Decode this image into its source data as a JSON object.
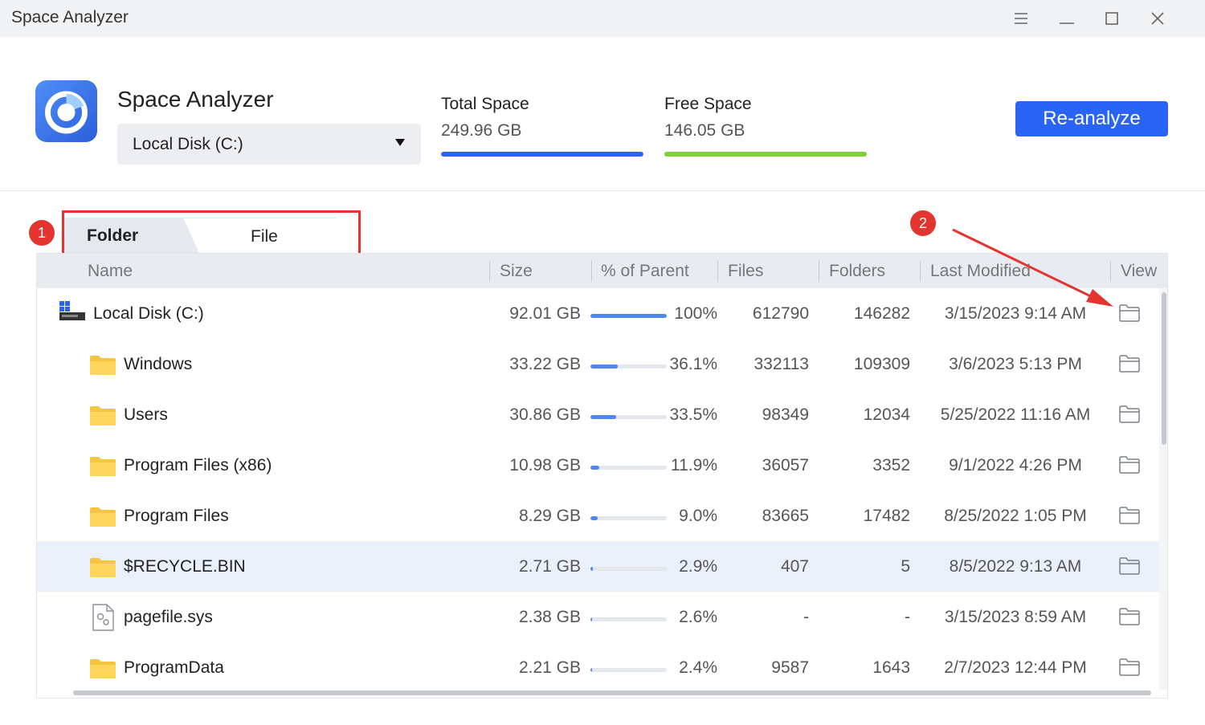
{
  "window": {
    "title": "Space Analyzer"
  },
  "header": {
    "app_name": "Space Analyzer",
    "disk_selected": "Local Disk (C:)",
    "total_space": {
      "label": "Total Space",
      "value": "249.96 GB",
      "fill": 1.0,
      "color": "#2a64f6"
    },
    "free_space": {
      "label": "Free Space",
      "value": "146.05 GB",
      "fill": 1.0,
      "color": "#7bd13b"
    },
    "reanalyze_label": "Re-analyze"
  },
  "annotations": {
    "badge_1": "1",
    "badge_2": "2"
  },
  "tabs": {
    "folder": "Folder",
    "file": "File",
    "active": "folder"
  },
  "columns": {
    "name": "Name",
    "size": "Size",
    "percent": "% of Parent",
    "files": "Files",
    "folders": "Folders",
    "modified": "Last Modified",
    "view": "View"
  },
  "rows": [
    {
      "name": "Local Disk (C:)",
      "type": "disk-icon",
      "size": "92.01 GB",
      "percent": "100%",
      "pct": 1.0,
      "files": "612790",
      "folders": "146282",
      "modified": "3/15/2023 9:14 AM"
    },
    {
      "name": "Windows",
      "type": "folder-icon",
      "size": "33.22 GB",
      "percent": "36.1%",
      "pct": 0.361,
      "files": "332113",
      "folders": "109309",
      "modified": "3/6/2023 5:13 PM"
    },
    {
      "name": "Users",
      "type": "folder-icon",
      "size": "30.86 GB",
      "percent": "33.5%",
      "pct": 0.335,
      "files": "98349",
      "folders": "12034",
      "modified": "5/25/2022 11:16 AM"
    },
    {
      "name": "Program Files (x86)",
      "type": "folder-icon",
      "size": "10.98 GB",
      "percent": "11.9%",
      "pct": 0.119,
      "files": "36057",
      "folders": "3352",
      "modified": "9/1/2022 4:26 PM"
    },
    {
      "name": "Program Files",
      "type": "folder-icon",
      "size": "8.29 GB",
      "percent": "9.0%",
      "pct": 0.09,
      "files": "83665",
      "folders": "17482",
      "modified": "8/25/2022 1:05 PM"
    },
    {
      "name": "$RECYCLE.BIN",
      "type": "folder-icon",
      "size": "2.71 GB",
      "percent": "2.9%",
      "pct": 0.029,
      "files": "407",
      "folders": "5",
      "modified": "8/5/2022 9:13 AM",
      "selected": true
    },
    {
      "name": "pagefile.sys",
      "type": "file-icon",
      "size": "2.38 GB",
      "percent": "2.6%",
      "pct": 0.026,
      "files": "-",
      "folders": "-",
      "modified": "3/15/2023 8:59 AM"
    },
    {
      "name": "ProgramData",
      "type": "folder-icon",
      "size": "2.21 GB",
      "percent": "2.4%",
      "pct": 0.024,
      "files": "9587",
      "folders": "1643",
      "modified": "2/7/2023 12:44 PM"
    }
  ]
}
